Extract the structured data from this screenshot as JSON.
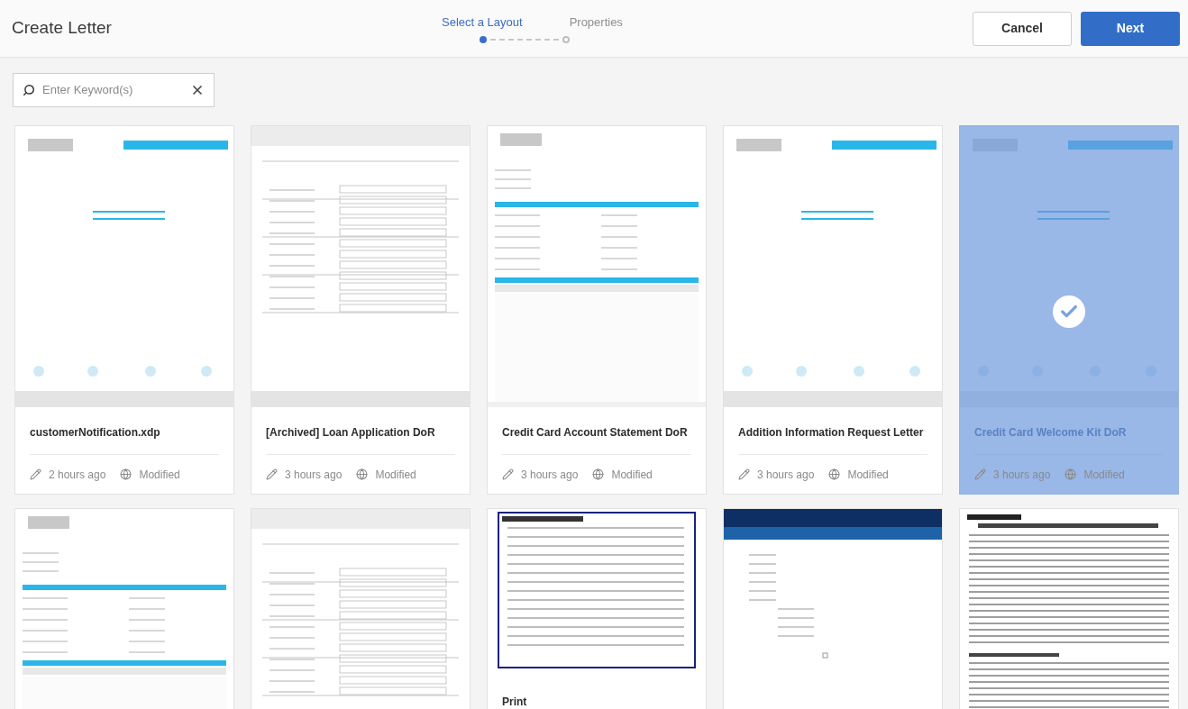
{
  "header": {
    "title": "Create Letter"
  },
  "steps": [
    {
      "label": "Select a Layout",
      "selected": true
    },
    {
      "label": "Properties",
      "selected": false
    }
  ],
  "buttons": {
    "cancel": "Cancel",
    "next": "Next"
  },
  "search": {
    "placeholder": "Enter Keyword(s)"
  },
  "cards": [
    {
      "thumbnail": {
        "kind": "letter"
      },
      "title": "customerNotification.xdp",
      "time": "2 hours ago",
      "status": "Modified",
      "selected": false
    },
    {
      "thumbnail": {
        "kind": "form"
      },
      "title": "[Archived] Loan Application DoR",
      "time": "3 hours ago",
      "status": "Modified",
      "selected": false
    },
    {
      "thumbnail": {
        "kind": "statement"
      },
      "title": "Credit Card Account Statement DoR",
      "time": "3 hours ago",
      "status": "Modified",
      "selected": false
    },
    {
      "thumbnail": {
        "kind": "letter"
      },
      "title": "Addition Information Request Letter",
      "time": "3 hours ago",
      "status": "Modified",
      "selected": false
    },
    {
      "thumbnail": {
        "kind": "letter"
      },
      "title": "Credit Card Welcome Kit DoR",
      "time": "3 hours ago",
      "status": "Modified",
      "selected": true
    },
    {
      "thumbnail": {
        "kind": "statement"
      },
      "selected": false
    },
    {
      "thumbnail": {
        "kind": "form"
      },
      "selected": false
    },
    {
      "thumbnail": {
        "kind": "boxed"
      },
      "title": "Print",
      "selected": false
    },
    {
      "thumbnail": {
        "kind": "banner"
      },
      "selected": false
    },
    {
      "thumbnail": {
        "kind": "dense"
      },
      "selected": false
    }
  ]
}
